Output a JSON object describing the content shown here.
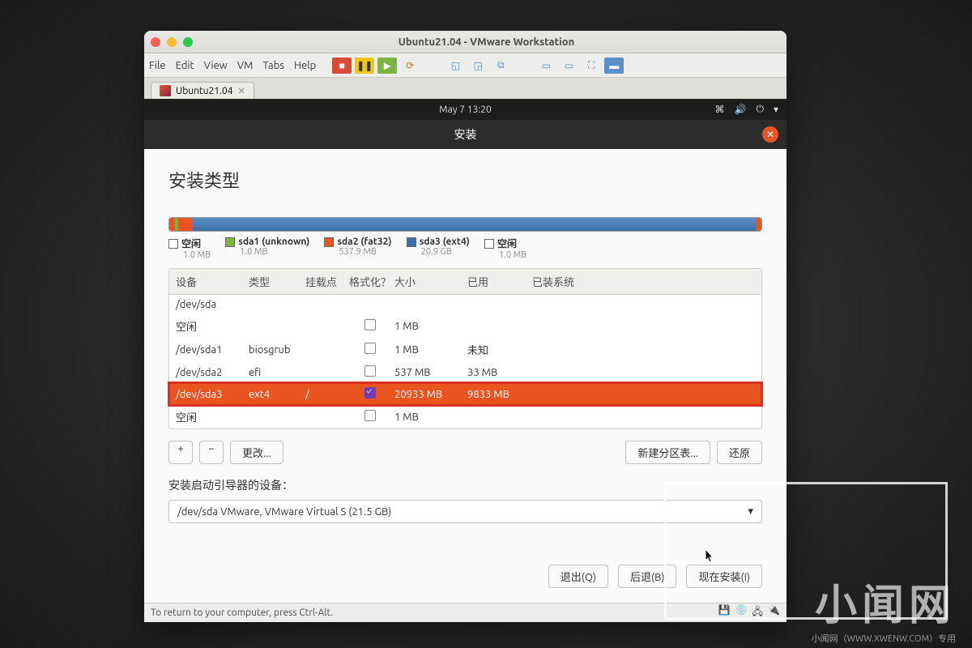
{
  "window": {
    "title": "Ubuntu21.04 - VMware Workstation",
    "tab": "Ubuntu21.04",
    "statusbar": "To return to your computer, press Ctrl-Alt."
  },
  "menubar": [
    "File",
    "Edit",
    "View",
    "VM",
    "Tabs",
    "Help"
  ],
  "gnome": {
    "clock": "May 7  13:20"
  },
  "installer": {
    "title": "安装",
    "section": "安装类型",
    "legend": [
      {
        "label": "空闲",
        "sub": "1.0 MB",
        "color": "#ffffff"
      },
      {
        "label": "sda1 (unknown)",
        "sub": "1.0 MB",
        "color": "#7cb342"
      },
      {
        "label": "sda2 (fat32)",
        "sub": "537.9 MB",
        "color": "#e95420"
      },
      {
        "label": "sda3 (ext4)",
        "sub": "20.9 GB",
        "color": "#3a6fa9"
      },
      {
        "label": "空闲",
        "sub": "1.0 MB",
        "color": "#ffffff"
      }
    ],
    "headers": {
      "dev": "设备",
      "type": "类型",
      "mount": "挂载点",
      "fmt": "格式化？",
      "size": "大小",
      "used": "已用",
      "sys": "已装系统"
    },
    "rows": [
      {
        "dev": "/dev/sda",
        "type": "",
        "mount": "",
        "fmt": null,
        "size": "",
        "used": "",
        "sys": "",
        "selected": false,
        "highlight": false
      },
      {
        "dev": "空闲",
        "type": "",
        "mount": "",
        "fmt": false,
        "size": "1 MB",
        "used": "",
        "sys": "",
        "selected": false,
        "highlight": false
      },
      {
        "dev": "/dev/sda1",
        "type": "biosgrub",
        "mount": "",
        "fmt": false,
        "size": "1 MB",
        "used": "未知",
        "sys": "",
        "selected": false,
        "highlight": false
      },
      {
        "dev": "/dev/sda2",
        "type": "efi",
        "mount": "",
        "fmt": false,
        "size": "537 MB",
        "used": "33 MB",
        "sys": "",
        "selected": false,
        "highlight": false
      },
      {
        "dev": "/dev/sda3",
        "type": "ext4",
        "mount": "/",
        "fmt": true,
        "size": "20933 MB",
        "used": "9833 MB",
        "sys": "",
        "selected": true,
        "highlight": true
      },
      {
        "dev": "空闲",
        "type": "",
        "mount": "",
        "fmt": false,
        "size": "1 MB",
        "used": "",
        "sys": "",
        "selected": false,
        "highlight": false
      }
    ],
    "buttons": {
      "add": "+",
      "remove": "−",
      "change": "更改...",
      "newtable": "新建分区表...",
      "revert": "还原"
    },
    "boot_label": "安装启动引导器的设备：",
    "boot_device": "/dev/sda   VMware, VMware Virtual S (21.5 GB)",
    "footer": {
      "quit": "退出(Q)",
      "back": "后退(B)",
      "install": "现在安装(I)"
    }
  },
  "watermark": {
    "main": "小闻网",
    "sub": "小闻网（WWW.XWENW.COM）专用"
  }
}
